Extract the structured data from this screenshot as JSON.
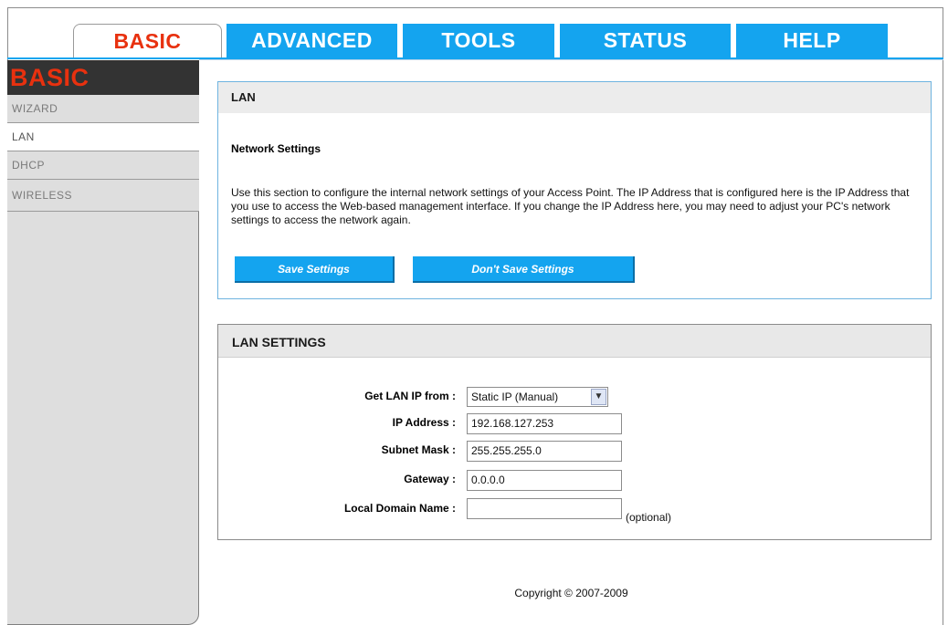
{
  "tabs": [
    {
      "label": "BASIC",
      "active": true
    },
    {
      "label": "ADVANCED",
      "active": false
    },
    {
      "label": "TOOLS",
      "active": false
    },
    {
      "label": "STATUS",
      "active": false
    },
    {
      "label": "HELP",
      "active": false
    }
  ],
  "sidebar": {
    "title": "BASIC",
    "items": [
      {
        "label": "WIZARD",
        "active": false
      },
      {
        "label": "LAN",
        "active": true
      },
      {
        "label": "DHCP",
        "active": false
      },
      {
        "label": "WIRELESS",
        "active": false
      }
    ]
  },
  "lan_panel": {
    "title": "LAN",
    "heading": "Network Settings",
    "description": "Use this section to configure the internal network settings of your Access Point. The IP Address that is configured here is the IP Address that you use to access the Web-based management interface. If you change the IP Address here, you may need to adjust your PC's network settings to access the network again.",
    "save_label": "Save Settings",
    "dont_save_label": "Don't Save Settings"
  },
  "settings_panel": {
    "title": "LAN SETTINGS",
    "get_ip_label": "Get LAN IP from :",
    "get_ip_value": "Static IP (Manual)",
    "ip_label": "IP Address :",
    "ip_value": "192.168.127.253",
    "subnet_label": "Subnet Mask :",
    "subnet_value": "255.255.255.0",
    "gateway_label": "Gateway :",
    "gateway_value": "0.0.0.0",
    "domain_label": "Local Domain Name :",
    "domain_value": "",
    "optional_note": "(optional)"
  },
  "footer": {
    "copyright": "Copyright © 2007-2009"
  },
  "colors": {
    "tab_blue": "#14a4ef",
    "brand_red": "#e8310f",
    "sidebar_dark": "#333333"
  }
}
